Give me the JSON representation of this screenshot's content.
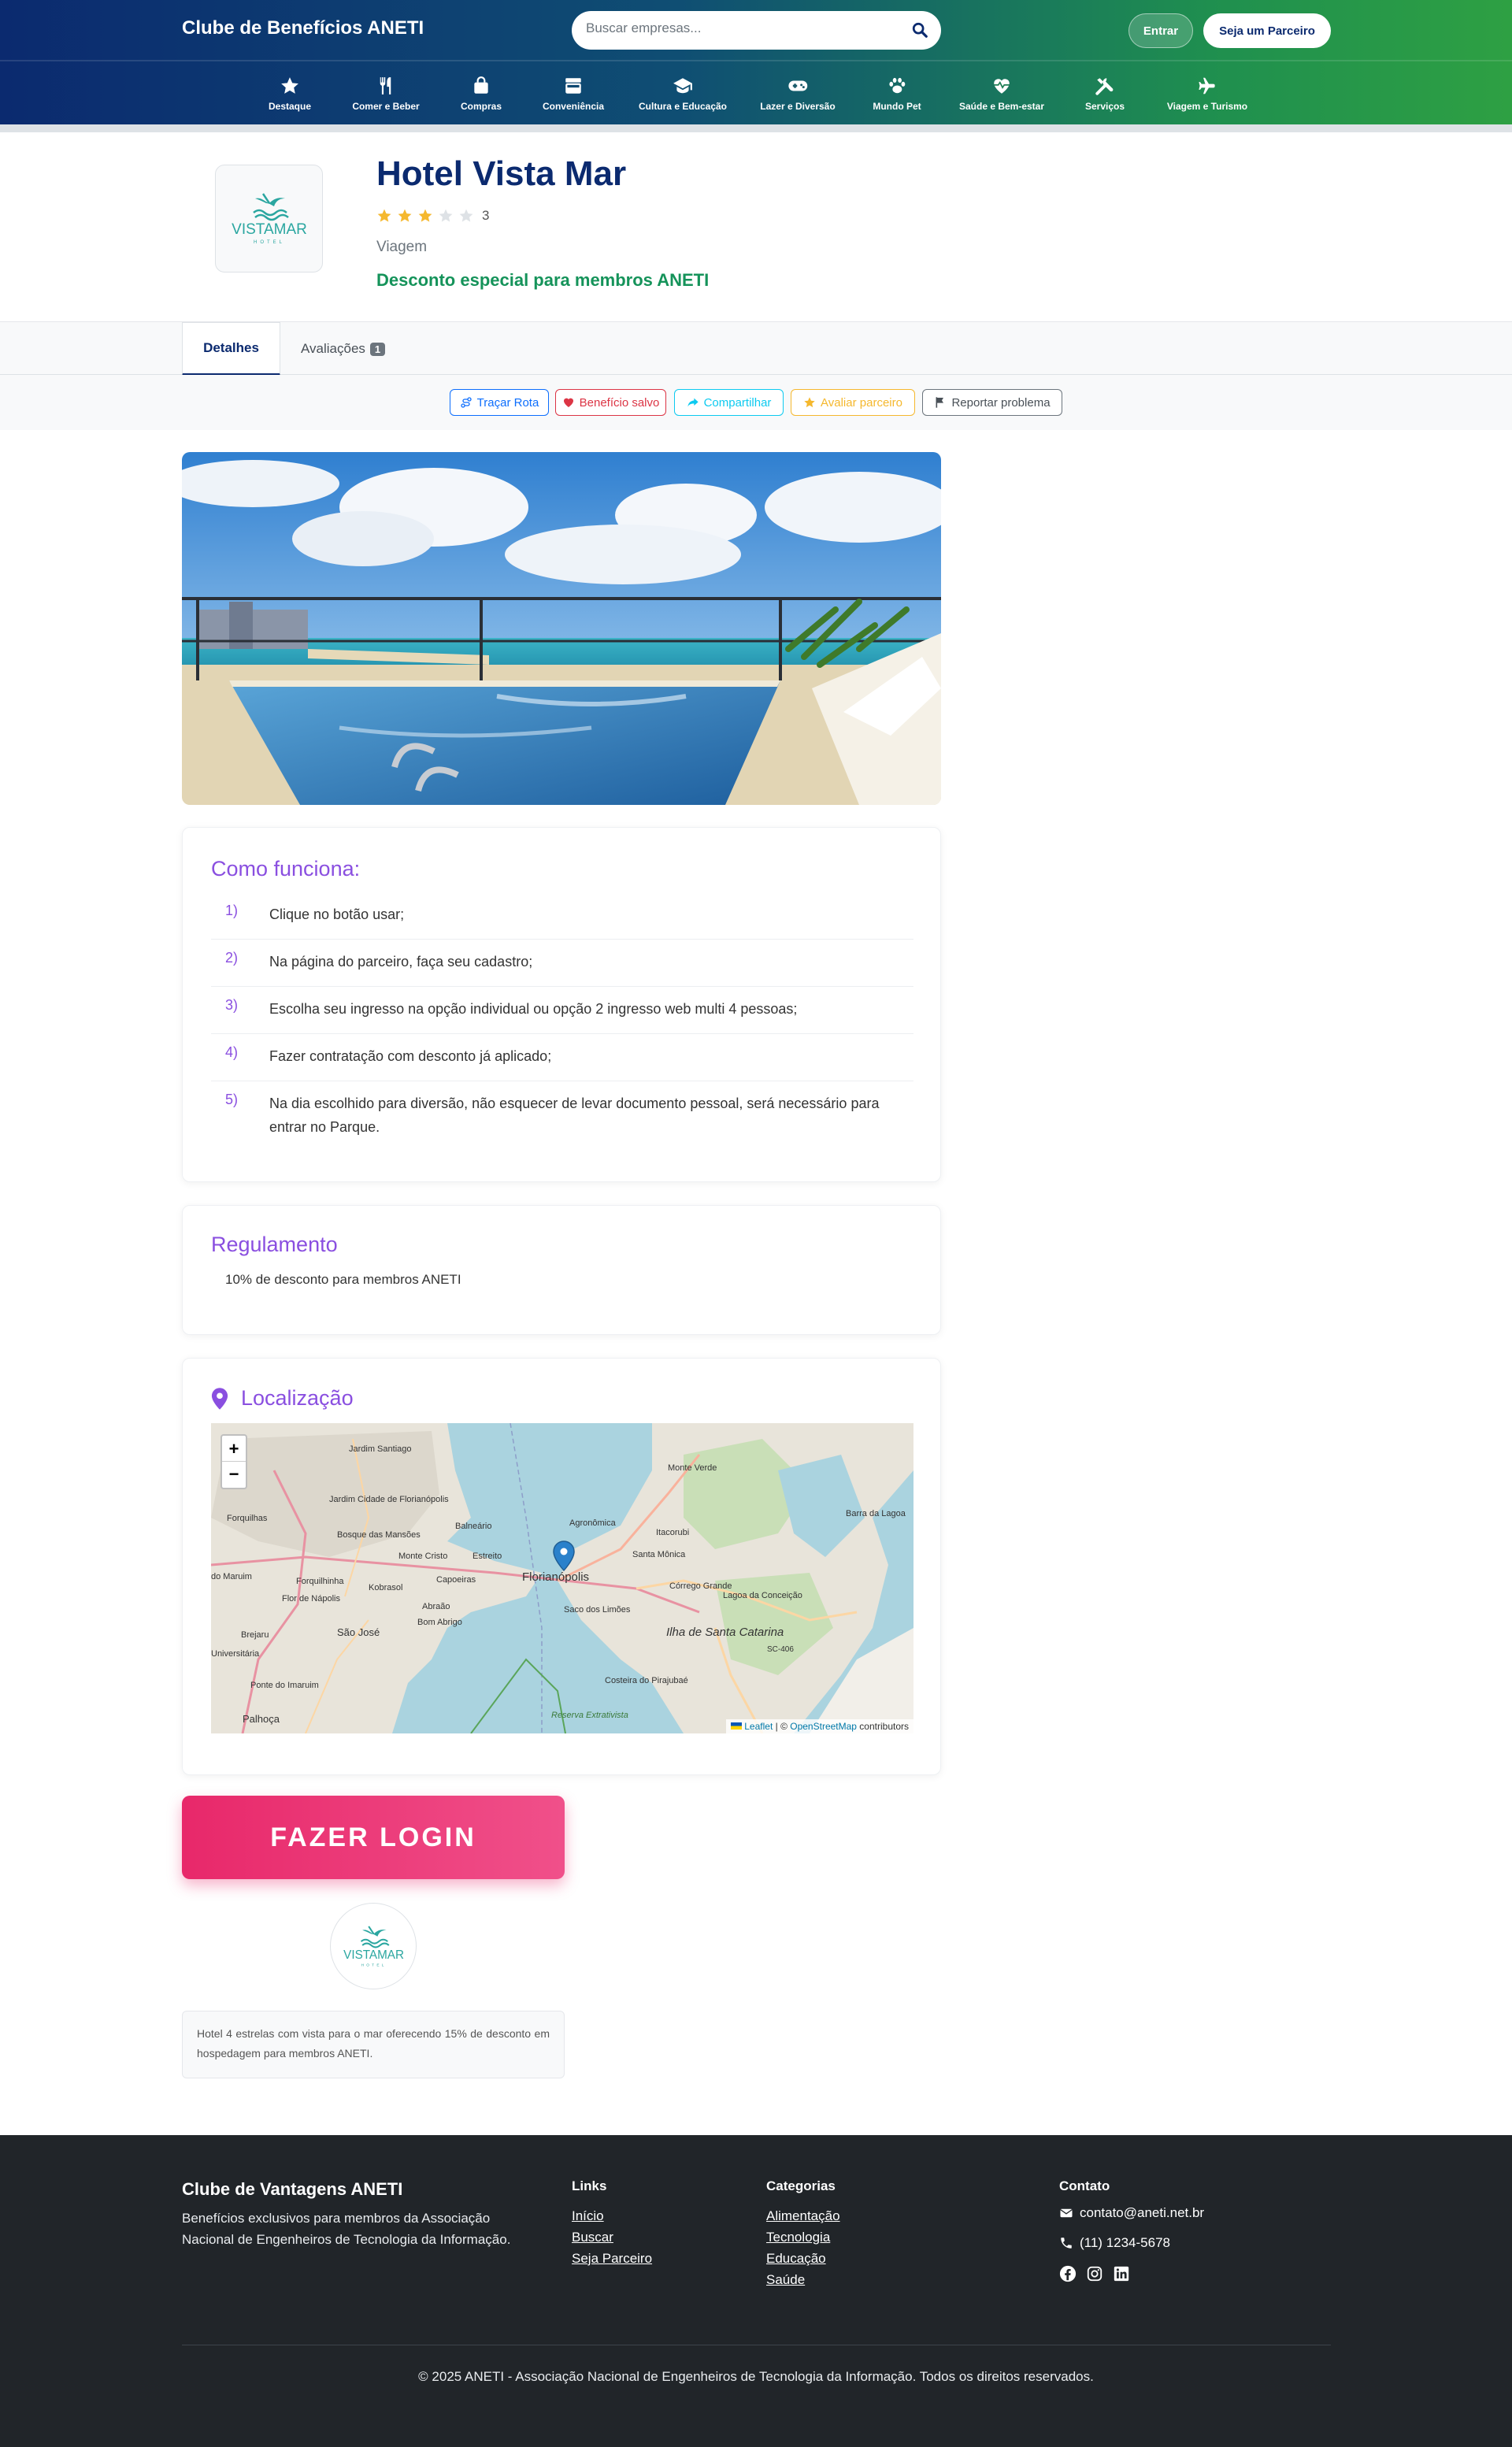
{
  "header": {
    "brand": "Clube de Benefícios ANETI",
    "search_placeholder": "Buscar empresas...",
    "login_label": "Entrar",
    "partner_label": "Seja um Parceiro"
  },
  "categories": [
    {
      "label": "Destaque",
      "icon": "star-icon"
    },
    {
      "label": "Comer e Beber",
      "icon": "utensils-icon"
    },
    {
      "label": "Compras",
      "icon": "shopping-bag-icon"
    },
    {
      "label": "Conveniência",
      "icon": "store-icon"
    },
    {
      "label": "Cultura e Educação",
      "icon": "graduation-cap-icon"
    },
    {
      "label": "Lazer e Diversão",
      "icon": "gamepad-icon"
    },
    {
      "label": "Mundo Pet",
      "icon": "paw-icon"
    },
    {
      "label": "Saúde e Bem-estar",
      "icon": "heart-pulse-icon"
    },
    {
      "label": "Serviços",
      "icon": "tools-icon"
    },
    {
      "label": "Viagem e Turismo",
      "icon": "plane-icon"
    }
  ],
  "partner": {
    "name": "Hotel Vista Mar",
    "rating": 3,
    "rating_max": 5,
    "rating_label": "3",
    "category": "Viagem",
    "discount": "Desconto especial para membros ANETI",
    "logo_text": "VISTAMAR",
    "logo_subtext": "HOTEL"
  },
  "tabs": {
    "details": "Detalhes",
    "reviews": "Avaliações",
    "reviews_count": "1"
  },
  "actions": {
    "route": "Traçar Rota",
    "saved": "Benefício salvo",
    "share": "Compartilhar",
    "rate": "Avaliar parceiro",
    "report": "Reportar problema"
  },
  "how_it_works": {
    "title": "Como funciona:",
    "steps": [
      {
        "num": "1)",
        "text": "Clique no botão usar;"
      },
      {
        "num": "2)",
        "text": "Na página do parceiro, faça seu cadastro;"
      },
      {
        "num": "3)",
        "text": "Escolha seu ingresso na opção individual ou opção 2 ingresso web multi 4 pessoas;"
      },
      {
        "num": "4)",
        "text": "Fazer contratação com desconto já aplicado;"
      },
      {
        "num": "5)",
        "text": "Na dia escolhido para diversão, não esquecer de levar documento pessoal, será necessário para entrar no Parque."
      }
    ]
  },
  "regulation": {
    "title": "Regulamento",
    "text": "10% de desconto para membros ANETI"
  },
  "location": {
    "title": "Localização",
    "zoom_in": "+",
    "zoom_out": "−",
    "attribution_leaflet": "Leaflet",
    "attribution_sep": " | © ",
    "attribution_osm": "OpenStreetMap",
    "attribution_tail": " contributors",
    "places": [
      "Monte Verde",
      "Jardim Santiago",
      "Jardim Cidade de Florianópolis",
      "Forquilhas",
      "Balneário",
      "Agronômica",
      "Lagoa da Conceição",
      "Bosque das Mansões",
      "Monte Cristo",
      "Estreito",
      "Florianópolis",
      "Santa Mônica",
      "Itacorubi",
      "do Maruim",
      "Forquilhinha",
      "Kobrasol",
      "Capoeiras",
      "Córrego Grande",
      "Flor de Nápolis",
      "Abraão",
      "Saco dos Limões",
      "Ilha de Santa Catarina",
      "Brejaru",
      "São José",
      "Bom Abrigo",
      "SC-406",
      "Universitária",
      "Barra da Lagoa",
      "Ponte do Imaruim",
      "Costeira do Pirajubaé",
      "Palhoça",
      "Reserva Extrativista"
    ]
  },
  "cta": {
    "login": "FAZER LOGIN"
  },
  "description": "Hotel 4 estrelas com vista para o mar oferecendo 15% de desconto em hospedagem para membros ANETI.",
  "footer": {
    "brand": "Clube de Vantagens ANETI",
    "description": "Benefícios exclusivos para membros da Associação Nacional de Engenheiros de Tecnologia da Informação.",
    "links_title": "Links",
    "links": [
      "Início",
      "Buscar",
      "Seja Parceiro"
    ],
    "categories_title": "Categorias",
    "categories": [
      "Alimentação",
      "Tecnologia",
      "Educação",
      "Saúde"
    ],
    "contact_title": "Contato",
    "email": "contato@aneti.net.br",
    "phone": "(11) 1234-5678",
    "copyright": "© 2025 ANETI - Associação Nacional de Engenheiros de Tecnologia da Informação. Todos os direitos reservados."
  },
  "colors": {
    "primary": "#0b2a6f",
    "accent_green": "#15935a",
    "section_title": "#8a4fe0",
    "login_pink": "#e8286a"
  }
}
